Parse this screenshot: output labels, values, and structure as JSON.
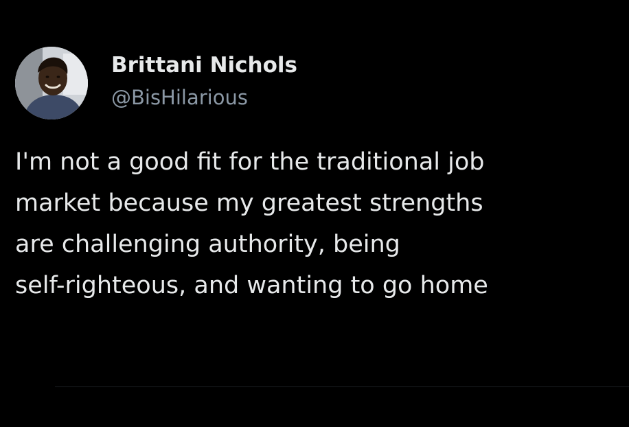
{
  "tweet": {
    "author": {
      "display_name": "Brittani Nichols",
      "handle": "@BisHilarious",
      "avatar": "profile-photo"
    },
    "text_lines": [
      "I'm not a good fit for the traditional job",
      "market because my greatest strengths",
      "are challenging authority, being",
      "self-righteous, and wanting to go home"
    ]
  },
  "colors": {
    "background": "#000000",
    "primary_text": "#e7e9ea",
    "secondary_text": "#8b98a5"
  }
}
